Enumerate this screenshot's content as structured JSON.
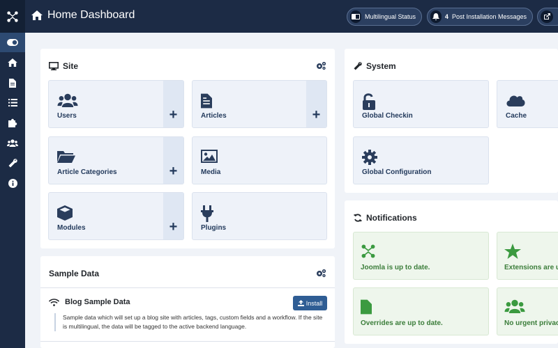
{
  "header": {
    "title": "Home Dashboard",
    "pills": [
      {
        "label": "Multilingual Status",
        "icon": "language-icon"
      },
      {
        "count": "4",
        "label": "Post Installation Messages",
        "icon": "bell-icon"
      },
      {
        "label": "",
        "icon": "external-link-icon"
      }
    ]
  },
  "sidebar": {
    "items": [
      "toggle-icon",
      "home-icon",
      "file-icon",
      "list-icon",
      "puzzle-icon",
      "users-icon",
      "wrench-icon",
      "info-icon"
    ]
  },
  "site": {
    "title": "Site",
    "tiles": [
      {
        "label": "Users",
        "icon": "users-icon",
        "add": "+"
      },
      {
        "label": "Articles",
        "icon": "file-text-icon",
        "add": "+"
      },
      {
        "label": "Article Categories",
        "icon": "folder-open-icon",
        "add": "+"
      },
      {
        "label": "Media",
        "icon": "image-icon"
      },
      {
        "label": "Modules",
        "icon": "cube-icon",
        "add": "+"
      },
      {
        "label": "Plugins",
        "icon": "plug-icon"
      }
    ]
  },
  "system": {
    "title": "System",
    "tiles": [
      {
        "label": "Global Checkin",
        "icon": "unlock-icon"
      },
      {
        "label": "Cache",
        "icon": "cloud-icon"
      },
      {
        "label": "Global Configuration",
        "icon": "gear-icon"
      }
    ]
  },
  "notifications": {
    "title": "Notifications",
    "tiles": [
      {
        "label": "Joomla is up to date.",
        "icon": "joomla-icon"
      },
      {
        "label": "Extensions are u",
        "icon": "star-icon"
      },
      {
        "label": "Overrides are up to date.",
        "icon": "file-icon"
      },
      {
        "label": "No urgent privac",
        "icon": "users-icon"
      }
    ]
  },
  "sample_data": {
    "title": "Sample Data",
    "item_title": "Blog Sample Data",
    "install_label": "Install",
    "description": "Sample data which will set up a blog site with articles, tags, custom fields and a workflow. If the site is multilingual, the data will be tagged to the active backend language."
  },
  "colors": {
    "header": "#1c2b45",
    "accent": "#2f5d94",
    "tile": "#eef2f9",
    "success": "#3b7d3a"
  }
}
